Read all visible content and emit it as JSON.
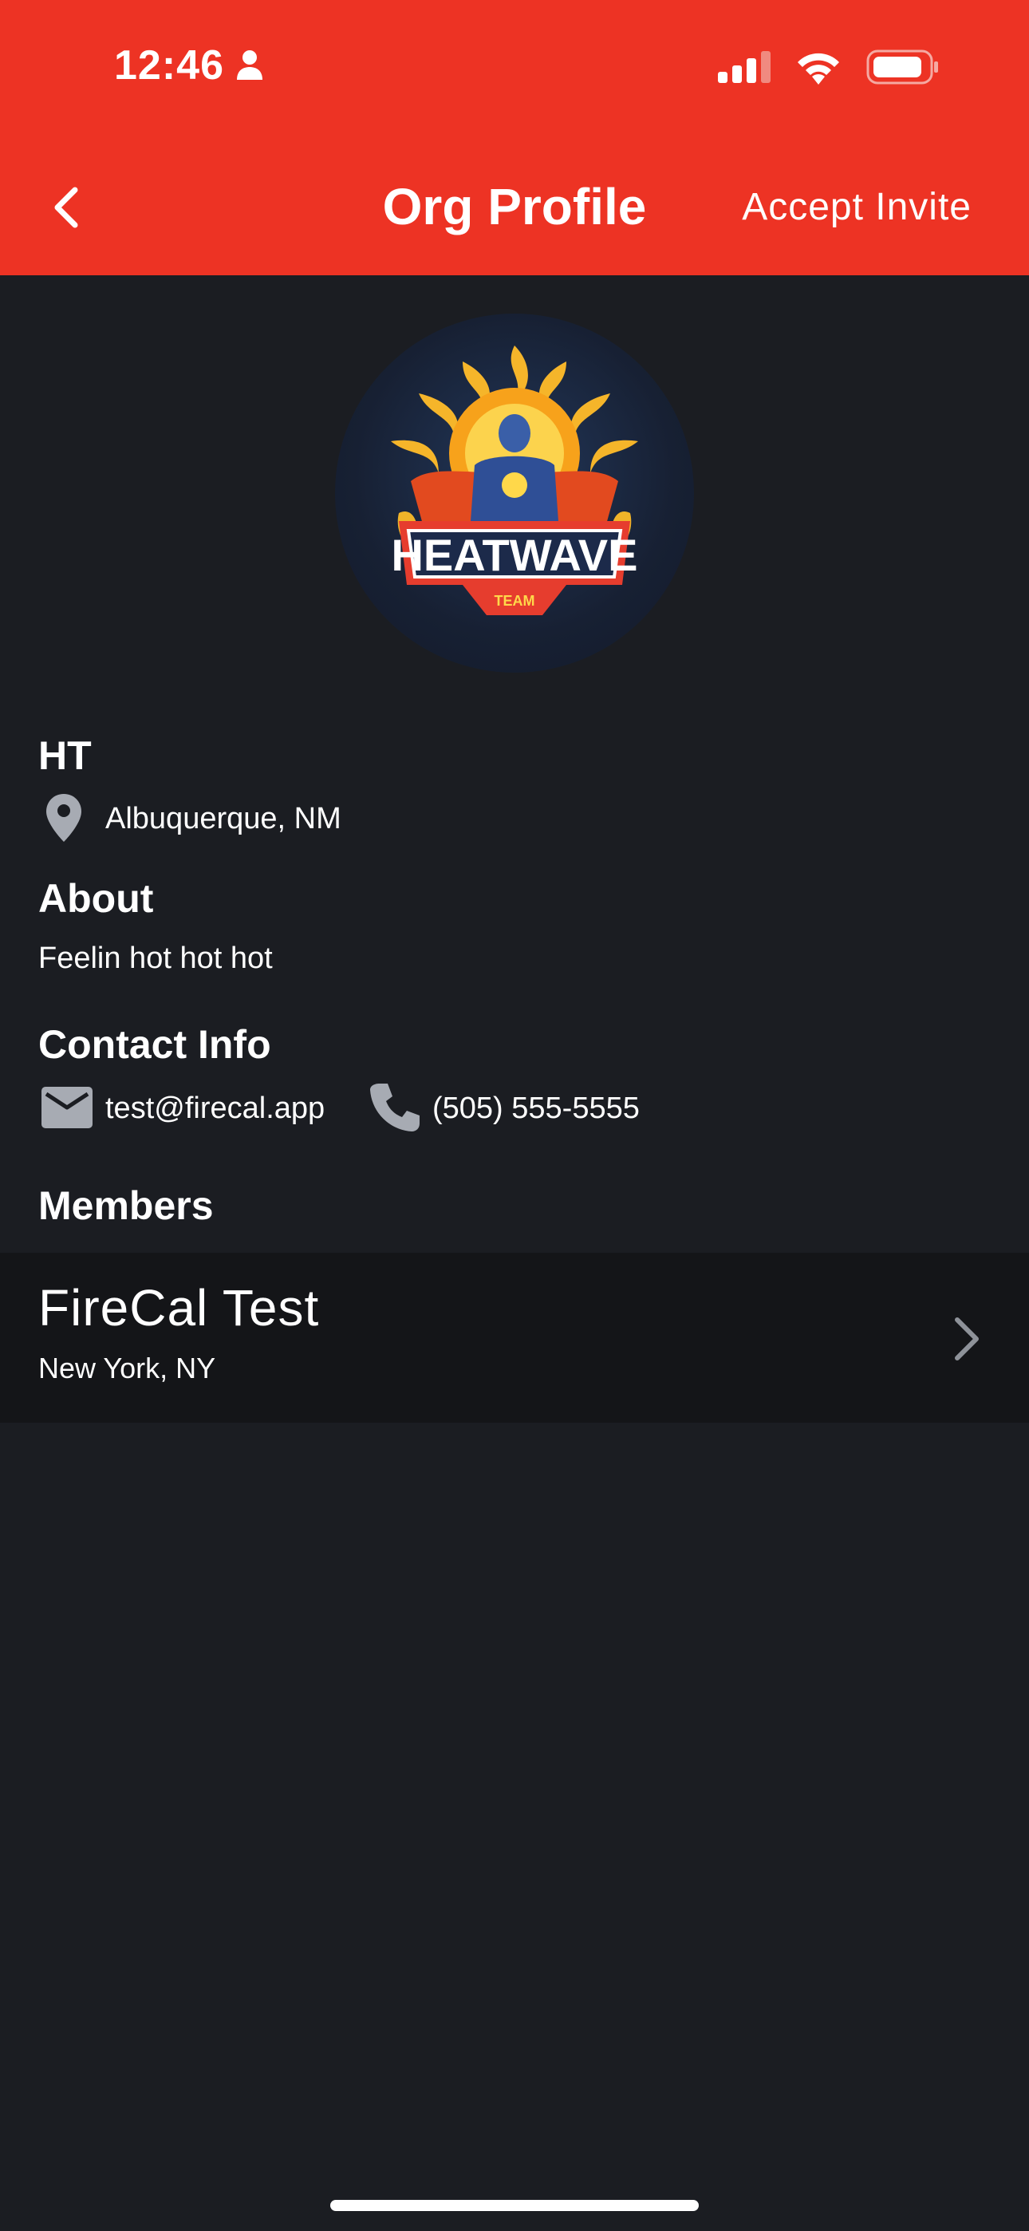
{
  "status_bar": {
    "time": "12:46"
  },
  "nav": {
    "title": "Org Profile",
    "accept_label": "Accept Invite"
  },
  "org": {
    "logo_text": "HEATWAVE",
    "logo_sub": "TEAM",
    "short_name": "HT",
    "location": "Albuquerque, NM"
  },
  "about": {
    "heading": "About",
    "text": "Feelin hot hot hot"
  },
  "contact": {
    "heading": "Contact Info",
    "email": "test@firecal.app",
    "phone": "(505) 555-5555"
  },
  "members": {
    "heading": "Members",
    "items": [
      {
        "name": "FireCal Test",
        "location": "New York, NY"
      }
    ]
  },
  "colors": {
    "accent": "#ed3324",
    "background": "#1b1d22",
    "row": "#141518",
    "icon_gray": "#a7abb3"
  }
}
